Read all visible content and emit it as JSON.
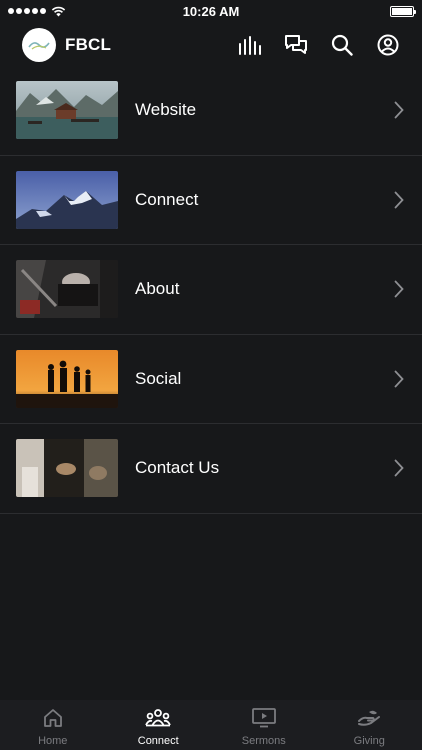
{
  "status_bar": {
    "time": "10:26 AM"
  },
  "header": {
    "brand": "FBCL"
  },
  "menu": [
    {
      "label": "Website"
    },
    {
      "label": "Connect"
    },
    {
      "label": "About"
    },
    {
      "label": "Social"
    },
    {
      "label": "Contact Us"
    }
  ],
  "tabs": [
    {
      "label": "Home",
      "active": false
    },
    {
      "label": "Connect",
      "active": true
    },
    {
      "label": "Sermons",
      "active": false
    },
    {
      "label": "Giving",
      "active": false
    }
  ],
  "colors": {
    "background": "#17181a",
    "inactive_tab": "#7b7c80",
    "divider": "#2c2d30"
  }
}
